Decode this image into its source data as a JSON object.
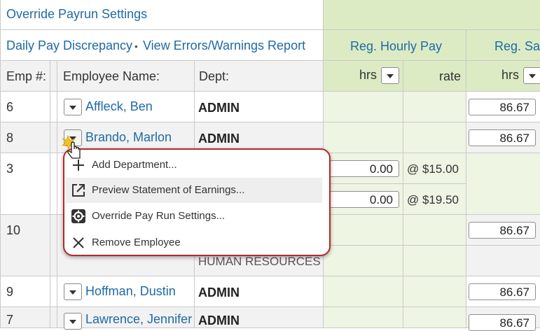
{
  "header": {
    "override_link": "Override Payrun Settings",
    "daily_pay_link": "Daily Pay Discrepancy",
    "separator": "•",
    "errors_link": "View Errors/Warnings Report",
    "reg_hourly_pay": "Reg. Hourly Pay",
    "reg_salary": "Reg. Sal"
  },
  "columns": {
    "emp": "Emp #:",
    "name": "Employee Name:",
    "dept": "Dept:",
    "hrs": "hrs",
    "rate": "rate",
    "hrs2": "hrs"
  },
  "rows": [
    {
      "emp": "6",
      "name": "Affleck, Ben",
      "dept": "ADMIN",
      "salary": "86.67"
    },
    {
      "emp": "8",
      "name": "Brando, Marlon",
      "dept": "ADMIN",
      "salary": "86.67"
    },
    {
      "emp": "3",
      "hours": [
        "0.00",
        "0.00"
      ],
      "rates": [
        "@ $15.00",
        "@ $19.50"
      ]
    },
    {
      "emp": "10",
      "dept2": "HUMAN RESOURCES",
      "salary": "86.67"
    },
    {
      "emp": "9",
      "name": "Hoffman, Dustin",
      "dept": "ADMIN",
      "salary": "86.67"
    },
    {
      "name": "Lawrence, Jennifer",
      "dept": "ADMIN",
      "salary": "86.67"
    }
  ],
  "menu": {
    "items": [
      {
        "label": "Add Department...",
        "icon": "plus-icon"
      },
      {
        "label": "Preview Statement of Earnings...",
        "icon": "external-link-icon"
      },
      {
        "label": "Override Pay Run Settings...",
        "icon": "gear-icon"
      },
      {
        "label": "Remove Employee",
        "icon": "close-icon"
      }
    ]
  }
}
